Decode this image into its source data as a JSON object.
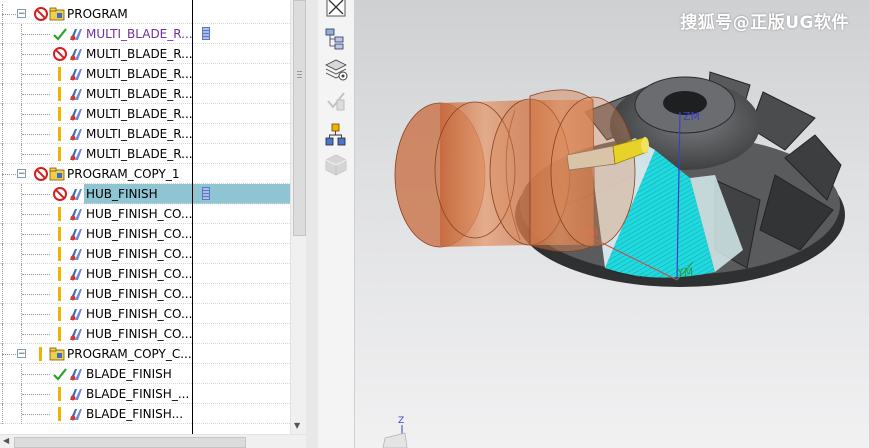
{
  "operation_navigator": {
    "rows": [
      {
        "label": "PROGRAM",
        "kind": "program",
        "status": "error"
      },
      {
        "label": "MULTI_BLADE_R...",
        "kind": "op",
        "status": "complete",
        "color": "purple",
        "path_icon": true
      },
      {
        "label": "MULTI_BLADE_R...",
        "kind": "op",
        "status": "error"
      },
      {
        "label": "MULTI_BLADE_R...",
        "kind": "op",
        "status": "regen"
      },
      {
        "label": "MULTI_BLADE_R...",
        "kind": "op",
        "status": "regen"
      },
      {
        "label": "MULTI_BLADE_R...",
        "kind": "op",
        "status": "regen"
      },
      {
        "label": "MULTI_BLADE_R...",
        "kind": "op",
        "status": "regen"
      },
      {
        "label": "MULTI_BLADE_R...",
        "kind": "op",
        "status": "regen"
      },
      {
        "label": "PROGRAM_COPY_1",
        "kind": "program",
        "status": "error"
      },
      {
        "label": "HUB_FINISH",
        "kind": "op",
        "status": "error",
        "selected": true,
        "path_icon": true
      },
      {
        "label": "HUB_FINISH_CO...",
        "kind": "op",
        "status": "regen"
      },
      {
        "label": "HUB_FINISH_CO...",
        "kind": "op",
        "status": "regen"
      },
      {
        "label": "HUB_FINISH_CO...",
        "kind": "op",
        "status": "regen"
      },
      {
        "label": "HUB_FINISH_CO...",
        "kind": "op",
        "status": "regen"
      },
      {
        "label": "HUB_FINISH_CO...",
        "kind": "op",
        "status": "regen"
      },
      {
        "label": "HUB_FINISH_CO...",
        "kind": "op",
        "status": "regen"
      },
      {
        "label": "HUB_FINISH_CO...",
        "kind": "op",
        "status": "regen"
      },
      {
        "label": "PROGRAM_COPY_C...",
        "kind": "program",
        "status": "regen"
      },
      {
        "label": "BLADE_FINISH",
        "kind": "op",
        "status": "complete"
      },
      {
        "label": "BLADE_FINISH_...",
        "kind": "op",
        "status": "regen"
      },
      {
        "label": "BLADE_FINISH...",
        "kind": "op",
        "status": "regen"
      }
    ]
  },
  "toolbar": {
    "icons": [
      "close-view-icon",
      "tool-view-icon",
      "machine-settings-icon",
      "verify-icon",
      "tree-view-icon",
      "shaded-cube-icon"
    ]
  },
  "viewport": {
    "watermark": "搜狐号@正版UG软件",
    "axis_labels": {
      "zm": "ZM",
      "xm": "XM",
      "ym": "YM",
      "z": "Z"
    }
  },
  "colors": {
    "selection": "#8fc4d2",
    "error": "#d42020",
    "complete": "#2aa12a",
    "regen": "#f2b300",
    "op_purple": "#7030a0",
    "impeller": "#4a4b4d",
    "toolpath": "#19e3e8",
    "tool_holder": "#d9834e"
  }
}
